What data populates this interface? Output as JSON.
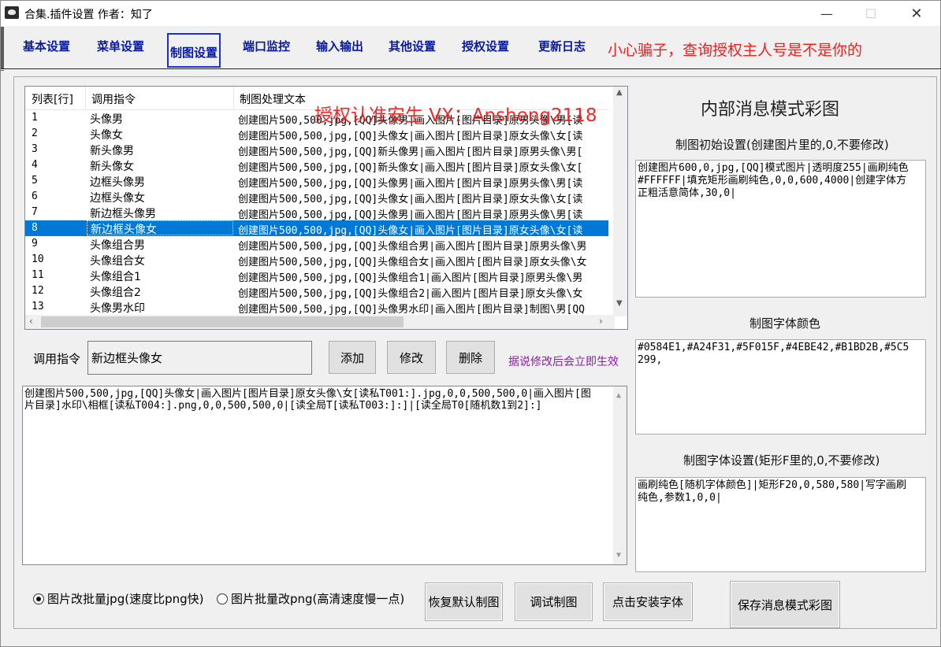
{
  "window": {
    "title": "合集.插件设置 作者：知了",
    "min": "—",
    "max": "☐",
    "close": "✕"
  },
  "tabs": [
    "基本设置",
    "菜单设置",
    "制图设置",
    "端口监控",
    "输入输出",
    "其他设置",
    "授权设置",
    "更新日志"
  ],
  "active_tab": "制图设置",
  "warning": "小心骗子，查询授权主人号是不是你的",
  "watermark": "授权认准安生 VX：Ansheng2118",
  "list": {
    "headers": [
      "列表[行]",
      "调用指令",
      "制图处理文本"
    ],
    "rows": [
      {
        "n": "1",
        "cmd": "头像男",
        "text": "创建图片500,500,jpg,[QQ]头像男|画入图片[图片目录]原男头像\\男[读"
      },
      {
        "n": "2",
        "cmd": "头像女",
        "text": "创建图片500,500,jpg,[QQ]头像女|画入图片[图片目录]原女头像\\女[读"
      },
      {
        "n": "3",
        "cmd": "新头像男",
        "text": "创建图片500,500,jpg,[QQ]新头像男|画入图片[图片目录]原男头像\\男["
      },
      {
        "n": "4",
        "cmd": "新头像女",
        "text": "创建图片500,500,jpg,[QQ]新头像女|画入图片[图片目录]原女头像\\女["
      },
      {
        "n": "5",
        "cmd": "边框头像男",
        "text": "创建图片500,500,jpg,[QQ]头像男|画入图片[图片目录]原男头像\\男[读"
      },
      {
        "n": "6",
        "cmd": "边框头像女",
        "text": "创建图片500,500,jpg,[QQ]头像女|画入图片[图片目录]原女头像\\女[读"
      },
      {
        "n": "7",
        "cmd": "新边框头像男",
        "text": "创建图片500,500,jpg,[QQ]头像男|画入图片[图片目录]原男头像\\男[读"
      },
      {
        "n": "8",
        "cmd": "新边框头像女",
        "text": "创建图片500,500,jpg,[QQ]头像女|画入图片[图片目录]原女头像\\女[读"
      },
      {
        "n": "9",
        "cmd": "头像组合男",
        "text": "创建图片500,500,jpg,[QQ]头像组合男|画入图片[图片目录]原男头像\\男"
      },
      {
        "n": "10",
        "cmd": "头像组合女",
        "text": "创建图片500,500,jpg,[QQ]头像组合女|画入图片[图片目录]原女头像\\女"
      },
      {
        "n": "11",
        "cmd": "头像组合1",
        "text": "创建图片500,500,jpg,[QQ]头像组合1|画入图片[图片目录]原男头像\\男"
      },
      {
        "n": "12",
        "cmd": "头像组合2",
        "text": "创建图片500,500,jpg,[QQ]头像组合2|画入图片[图片目录]原女头像\\女"
      },
      {
        "n": "13",
        "cmd": "头像男水印",
        "text": "创建图片500,500,jpg,[QQ]头像男水印|画入图片[图片目录]制图\\男[QQ"
      }
    ],
    "selected_row": "8"
  },
  "command": {
    "label": "调用指令",
    "value": "新边框头像女"
  },
  "buttons": {
    "add": "添加",
    "edit": "修改",
    "delete": "删除",
    "restore": "恢复默认制图",
    "debug": "调试制图",
    "install_font": "点击安装字体",
    "save": "保存消息模式彩图"
  },
  "note": "据说修改后会立即生效",
  "process_text": "创建图片500,500,jpg,[QQ]头像女|画入图片[图片目录]原女头像\\女[读私T001:].jpg,0,0,500,500,0|画入图片[图片目录]水印\\相框[读私T004:].png,0,0,500,500,0|[读全局T[读私T003:]:]|[读全局T0[随机数1到2]:]",
  "right": {
    "title": "内部消息模式彩图",
    "init_label": "制图初始设置(创建图片里的,0,不要修改)",
    "init_value": "创建图片600,0,jpg,[QQ]模式图片|透明度255|画刷纯色#FFFFFF|填充矩形画刷纯色,0,0,600,4000|创建字体方正粗活意简体,30,0|",
    "color_label": "制图字体颜色",
    "color_value": "#0584E1,#A24F31,#5F015F,#4EBE42,#B1BD2B,#5C5299,",
    "font_label": "制图字体设置(矩形F里的,0,不要修改)",
    "font_value": "画刷纯色[随机字体颜色]|矩形F20,0,580,580|写字画刷纯色,参数1,0,0|"
  },
  "radios": [
    {
      "label": "图片改批量jpg(速度比png快)",
      "checked": true
    },
    {
      "label": "图片批量改png(高清速度慢一点)",
      "checked": false
    }
  ],
  "colors": {
    "tab_text": "#0a1a9c",
    "warning": "#ee1f1f",
    "selection": "#0078d7",
    "note": "#8b1fa8"
  }
}
